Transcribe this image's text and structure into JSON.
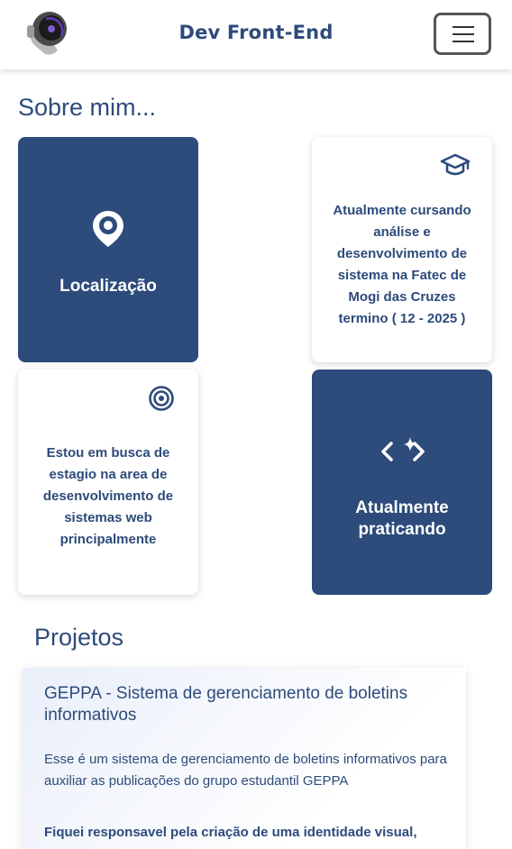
{
  "header": {
    "title": "Dev Front-End",
    "logo_icon": "astronaut-helmet-logo",
    "menu_icon": "hamburger-menu-icon"
  },
  "about": {
    "title": "Sobre mim...",
    "cards": [
      {
        "type": "dark",
        "icon": "location-pin-icon",
        "label": "Localização"
      },
      {
        "type": "light",
        "icon": "graduation-cap-icon",
        "text": "Atualmente cursando análise e desenvolvimento de sistema na Fatec de Mogi das Cruzes termino ( 12 - 2025 )"
      },
      {
        "type": "light",
        "icon": "target-icon",
        "text": "Estou em busca de estagio na area de desenvolvimento de sistemas web principalmente"
      },
      {
        "type": "dark",
        "icon": "code-sparkle-icon",
        "label": "Atualmente praticando"
      }
    ]
  },
  "projects": {
    "title": "Projetos",
    "items": [
      {
        "title": "GEPPA - Sistema de gerenciamento de boletins informativos",
        "description": "Esse é um sistema de gerenciamento de boletins informativos para auxiliar as publicações do grupo estudantil GEPPA",
        "responsibility": "Fiquei responsavel pela criação de uma identidade visual,"
      }
    ]
  },
  "colors": {
    "primary": "#2d4b7b",
    "background": "#ffffff"
  }
}
